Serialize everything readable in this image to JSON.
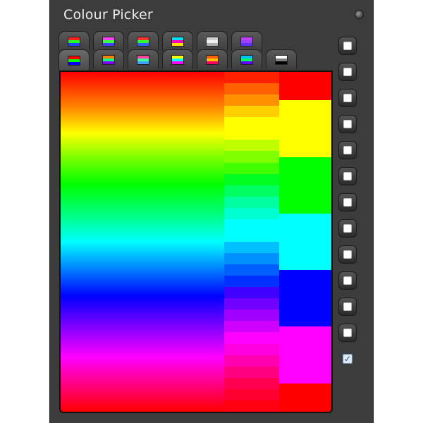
{
  "window": {
    "title": "Colour Picker"
  },
  "tabs_row1": [
    {
      "icon": "rgb-sliders-icon",
      "colors": [
        "#ff2020",
        "#20ff20",
        "#2040ff"
      ]
    },
    {
      "icon": "hsv-sliders-icon",
      "colors": [
        "#ff40ff",
        "#40ff40",
        "#4040ff"
      ]
    },
    {
      "icon": "colour-wheel-icon",
      "colors": [
        "#ff3030",
        "#30ff30",
        "#3060ff"
      ]
    },
    {
      "icon": "cmyk-sliders-icon",
      "colors": [
        "#00e0ff",
        "#ff00c0",
        "#ffe000"
      ]
    },
    {
      "icon": "eyedropper-icon",
      "colors": [
        "#d0d0d0",
        "#f0f0f0",
        "#b0b0b0"
      ]
    },
    {
      "icon": "gamma-curve-icon",
      "colors": [
        "#c040ff",
        "#a040ff",
        "#6030ff"
      ]
    }
  ],
  "tabs_row2": [
    {
      "icon": "palette-spectrum-icon",
      "colors": [
        "#ff0000",
        "#00ff00",
        "#0000ff"
      ],
      "active": true
    },
    {
      "icon": "palette-grid-icon",
      "colors": [
        "#ff8000",
        "#00ff80",
        "#8000ff"
      ]
    },
    {
      "icon": "palette-mix-icon",
      "colors": [
        "#ff40a0",
        "#40ffa0",
        "#40a0ff"
      ]
    },
    {
      "icon": "palette-stripes-icon",
      "colors": [
        "#ffff00",
        "#00ffff",
        "#ff00ff"
      ]
    },
    {
      "icon": "palette-warm-icon",
      "colors": [
        "#ff6000",
        "#ffc000",
        "#ff0060"
      ]
    },
    {
      "icon": "palette-cool-icon",
      "colors": [
        "#00c0ff",
        "#00ff60",
        "#6000ff"
      ]
    },
    {
      "icon": "palette-grayscale-icon",
      "colors": [
        "#ffffff",
        "#808080",
        "#000000"
      ]
    }
  ],
  "palette": {
    "mid_column": [
      "#ff2000",
      "#ff6000",
      "#ff9000",
      "#ffd000",
      "#ffff00",
      "#ffff00",
      "#c0ff00",
      "#80ff00",
      "#40ff00",
      "#00ff20",
      "#00ff60",
      "#00ffa0",
      "#00ffd0",
      "#00ffff",
      "#00ffff",
      "#00c0ff",
      "#0090ff",
      "#0060ff",
      "#0030ff",
      "#4000ff",
      "#7000ff",
      "#a000ff",
      "#d000ff",
      "#ff00ff",
      "#ff00e0",
      "#ff00b0",
      "#ff0080",
      "#ff0050",
      "#ff0030",
      "#ff0010"
    ],
    "right_column": [
      "#ff0000",
      "#ffff00",
      "#00ff00",
      "#00ffff",
      "#0000ff",
      "#ff00ff",
      "#ff0000"
    ],
    "right_column_weights": [
      1,
      2,
      2,
      2,
      2,
      2,
      1
    ]
  },
  "side_buttons": [
    {
      "name": "swatch-button-1",
      "checked": false
    },
    {
      "name": "swatch-button-2",
      "checked": false
    },
    {
      "name": "swatch-button-3",
      "checked": false
    },
    {
      "name": "swatch-button-4",
      "checked": false
    },
    {
      "name": "swatch-button-5",
      "checked": false
    },
    {
      "name": "swatch-button-6",
      "checked": false
    },
    {
      "name": "swatch-button-7",
      "checked": false
    },
    {
      "name": "swatch-button-8",
      "checked": false
    },
    {
      "name": "swatch-button-9",
      "checked": false
    },
    {
      "name": "swatch-button-10",
      "checked": false
    },
    {
      "name": "swatch-button-11",
      "checked": false
    },
    {
      "name": "swatch-button-12",
      "checked": false
    },
    {
      "name": "swatch-checkbox",
      "checked": true
    }
  ],
  "colors": {
    "panel": "#3c3c3c",
    "title_text": "#ececec"
  }
}
